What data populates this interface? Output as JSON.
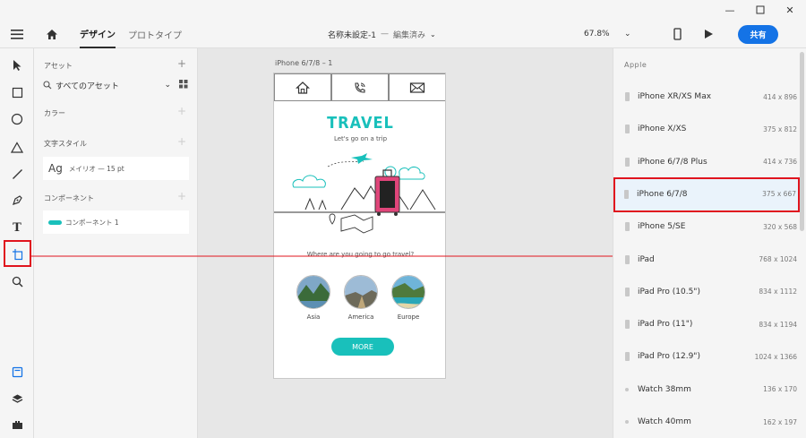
{
  "appbar": {
    "tab_design": "デザイン",
    "tab_prototype": "プロトタイプ",
    "doc_title": "名称未設定-1",
    "doc_sep": "—",
    "doc_status": "編集済み",
    "zoom": "67.8%",
    "share": "共有"
  },
  "assets": {
    "header": "アセット",
    "filter": "すべてのアセット",
    "colors": "カラー",
    "text_styles": "文字スタイル",
    "text_style_sample": "Ag",
    "text_style_name": "メイリオ — 15 pt",
    "components": "コンポーネント",
    "component_name": "コンポーネント 1"
  },
  "canvas": {
    "artboard_label": "iPhone 6/7/8 – 1",
    "travel_title": "TRAVEL",
    "travel_sub": "Let's go on a trip",
    "question": "Where are you going to go travel?",
    "destinations": [
      "Asia",
      "America",
      "Europe"
    ],
    "more": "MORE"
  },
  "devices": {
    "group": "Apple",
    "items": [
      {
        "name": "iPhone XR/XS Max",
        "size": "414 x 896"
      },
      {
        "name": "iPhone X/XS",
        "size": "375 x 812"
      },
      {
        "name": "iPhone 6/7/8 Plus",
        "size": "414 x 736"
      },
      {
        "name": "iPhone 6/7/8",
        "size": "375 x 667"
      },
      {
        "name": "iPhone 5/SE",
        "size": "320 x 568"
      },
      {
        "name": "iPad",
        "size": "768 x 1024"
      },
      {
        "name": "iPad Pro (10.5\")",
        "size": "834 x 1112"
      },
      {
        "name": "iPad Pro (11\")",
        "size": "834 x 1194"
      },
      {
        "name": "iPad Pro (12.9\")",
        "size": "1024 x 1366"
      },
      {
        "name": "Watch 38mm",
        "size": "136 x 170"
      },
      {
        "name": "Watch 40mm",
        "size": "162 x 197"
      }
    ],
    "selected_index": 3
  },
  "colors": {
    "accent": "#1473e6",
    "teal": "#19c0bb",
    "highlight": "#e0141e"
  }
}
